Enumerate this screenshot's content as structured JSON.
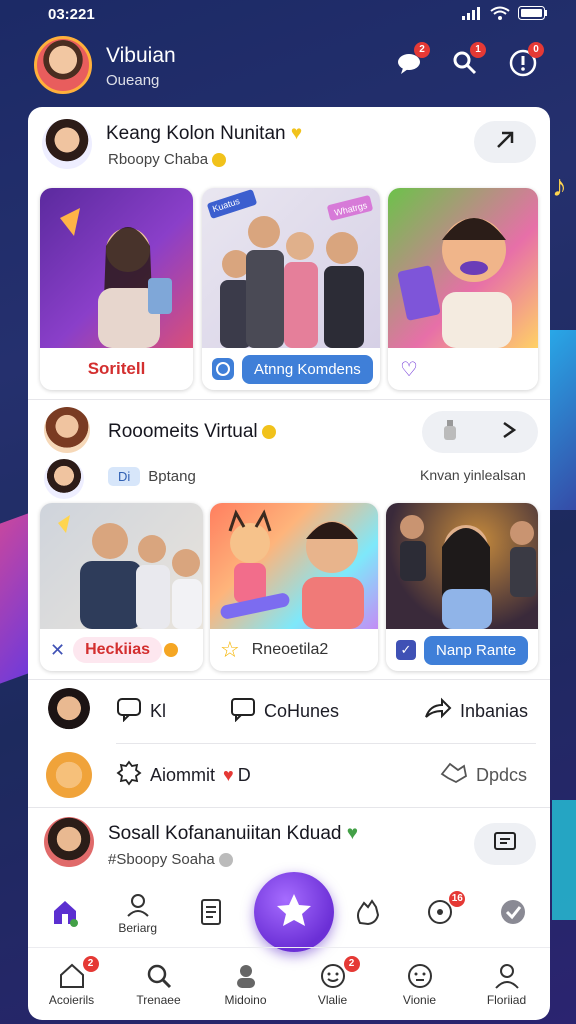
{
  "status": {
    "time": "03:221"
  },
  "header": {
    "name": "Vibuian",
    "subtitle": "Oueang",
    "badges": [
      "2",
      "1",
      "0"
    ]
  },
  "post1": {
    "name": "Keang Kolon Nunitan",
    "subtitle": "Rboopy Chaba",
    "tiles": [
      {
        "label": "Soritell"
      },
      {
        "label": "Atnng Komdens",
        "sticker_left": "Kuatus",
        "sticker_right": "Whatrgs"
      },
      {
        "label": ""
      }
    ]
  },
  "post2": {
    "name": "Rooomeits Virtual",
    "chip": "Di",
    "subtitle": "Bptang",
    "location": "Knvan yinlealsan",
    "tiles": [
      {
        "label": "Heckiias"
      },
      {
        "label": "Rneoetila2"
      },
      {
        "label": "Nanp Rante"
      }
    ]
  },
  "actions": {
    "like": "Kl",
    "comment": "CoHunes",
    "share": "Inbanias"
  },
  "comment_row": {
    "text": "Aiommit",
    "suffix": "D",
    "right": "Dpdcs"
  },
  "post3": {
    "name": "Sosall Kofananuiitan Kduad",
    "subtitle": "#Sboopy Soaha"
  },
  "nav_top": [
    {
      "label": "",
      "icon": "home-icon"
    },
    {
      "label": "Beriarg",
      "icon": "profile-icon"
    },
    {
      "label": "",
      "icon": "music-icon"
    },
    {
      "label": "",
      "icon": "star-icon"
    },
    {
      "label": "",
      "icon": "hand-icon"
    },
    {
      "label": "",
      "icon": "notification-icon",
      "badge": "16"
    },
    {
      "label": "",
      "icon": "settings-icon"
    }
  ],
  "nav_bottom": [
    {
      "label": "Acoierils",
      "icon": "home-icon",
      "badge": "2"
    },
    {
      "label": "Trenaee",
      "icon": "search-icon"
    },
    {
      "label": "Midoino",
      "icon": "people-icon"
    },
    {
      "label": "Vlalie",
      "icon": "smile-icon",
      "badge": "2"
    },
    {
      "label": "Vionie",
      "icon": "globe-icon"
    },
    {
      "label": "Floriiad",
      "icon": "user-icon"
    }
  ],
  "colors": {
    "accent": "#6b2fd6",
    "link_blue": "#3f7fd8",
    "badge_red": "#e53935",
    "bg": "#1f2a66"
  }
}
